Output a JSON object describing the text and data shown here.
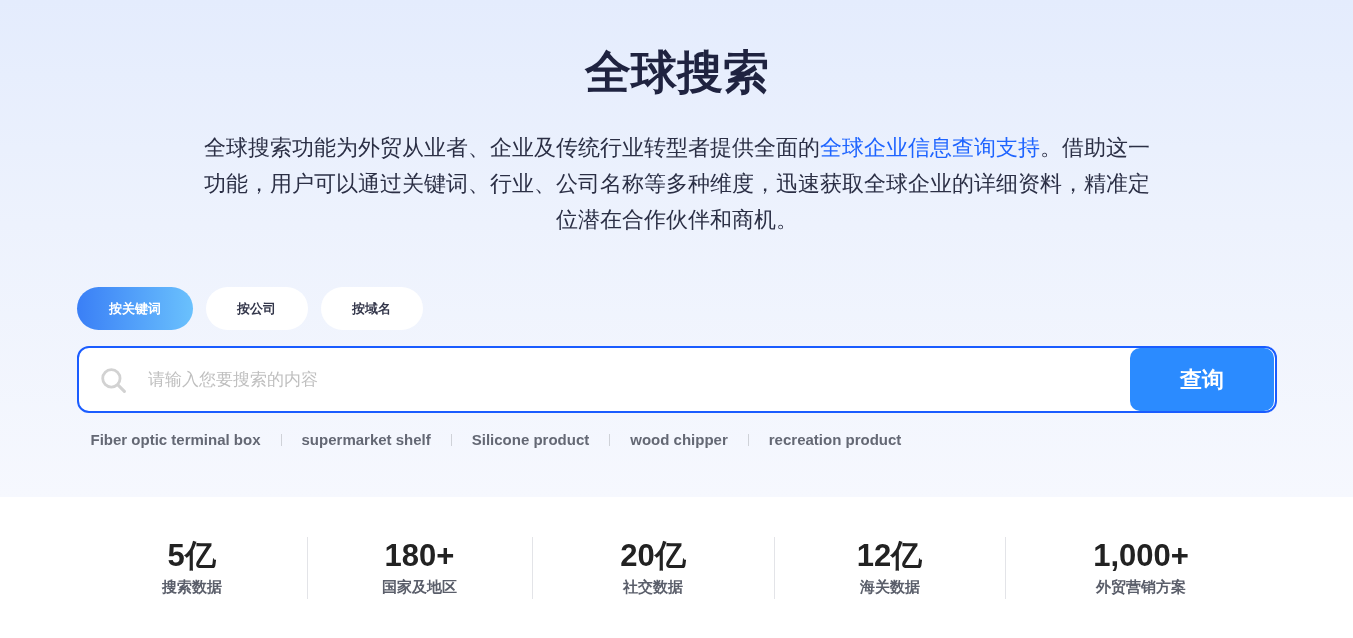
{
  "title": "全球搜索",
  "description": {
    "before": "全球搜索功能为外贸从业者、企业及传统行业转型者提供全面的",
    "link": "全球企业信息查询支持",
    "after": "。借助这一功能，用户可以通过关键词、行业、公司名称等多种维度，迅速获取全球企业的详细资料，精准定位潜在合作伙伴和商机。"
  },
  "tabs": [
    {
      "label": "按关键词",
      "selected": true
    },
    {
      "label": "按公司",
      "selected": false
    },
    {
      "label": "按域名",
      "selected": false
    }
  ],
  "search": {
    "placeholder": "请输入您要搜索的内容",
    "button": "查询"
  },
  "hot_keywords": [
    "Fiber optic terminal box",
    "supermarket shelf",
    "Silicone product",
    "wood chipper",
    "recreation product"
  ],
  "stats": [
    {
      "value": "5亿",
      "label": "搜索数据"
    },
    {
      "value": "180+",
      "label": "国家及地区"
    },
    {
      "value": "20亿",
      "label": "社交数据"
    },
    {
      "value": "12亿",
      "label": "海关数据"
    },
    {
      "value": "1,000+",
      "label": "外贸营销方案"
    }
  ]
}
